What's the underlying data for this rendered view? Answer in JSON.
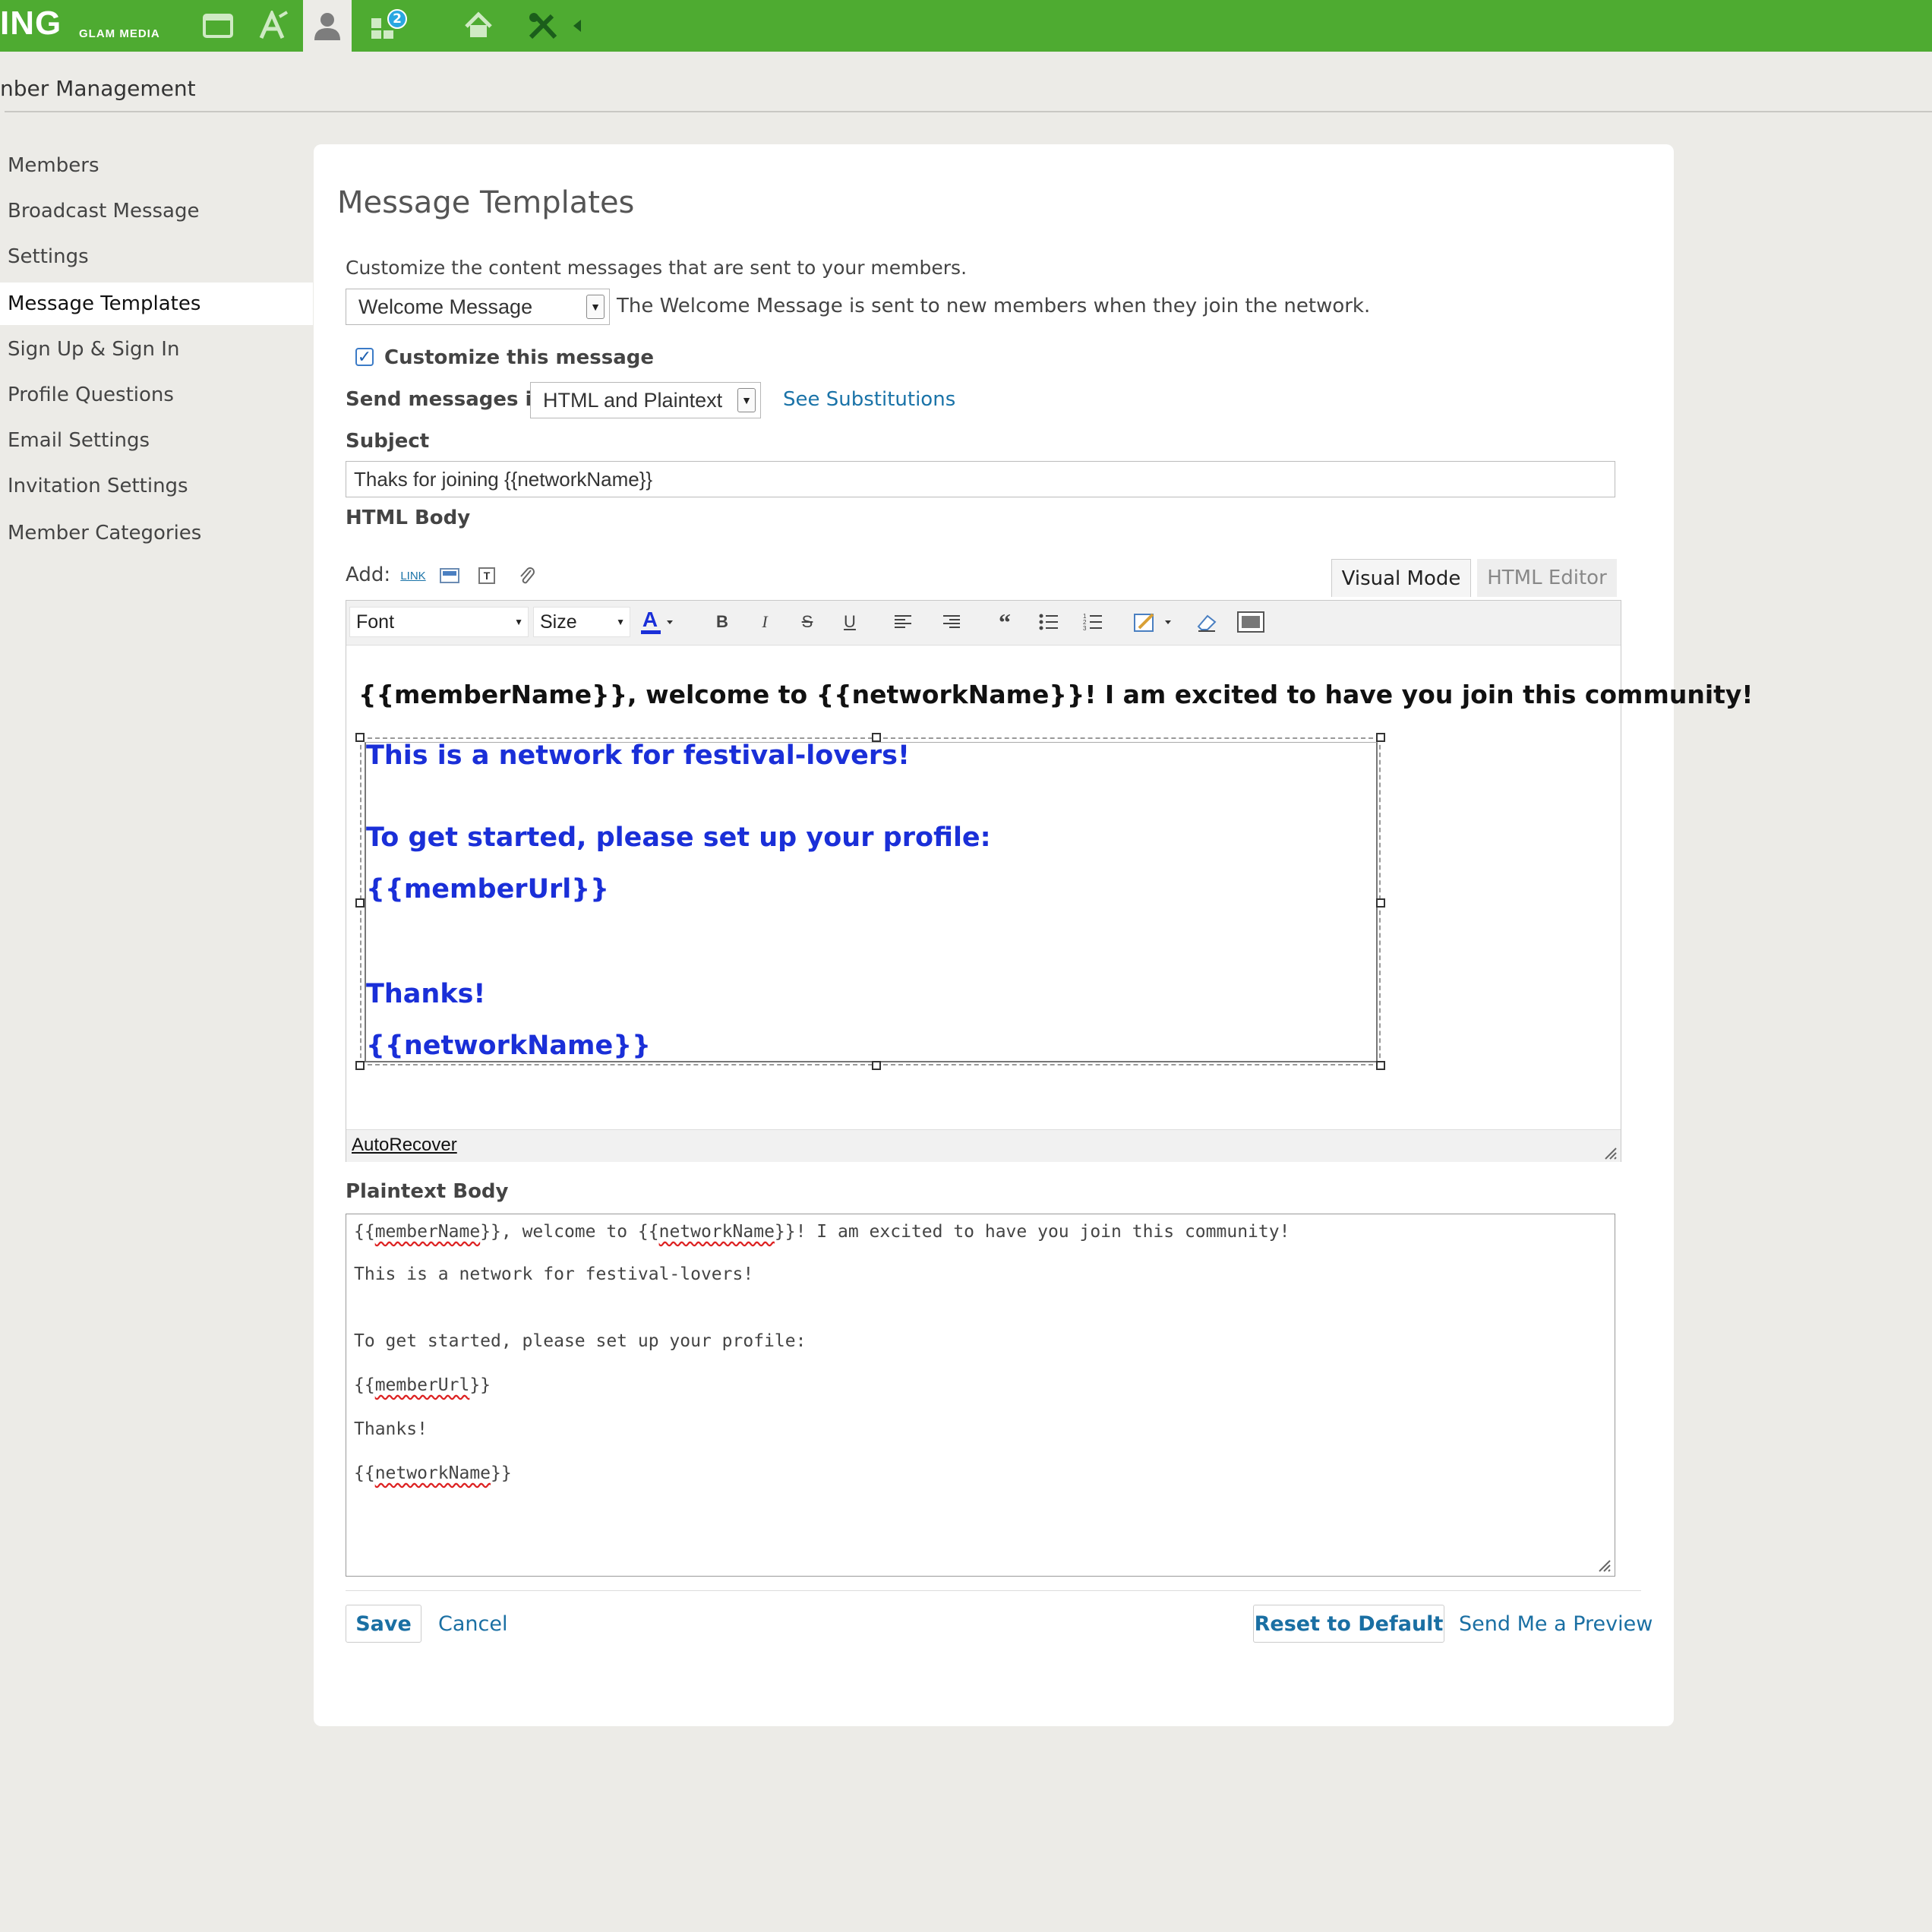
{
  "topbar": {
    "logo": "ING",
    "logo_sub": "GLAM MEDIA",
    "notification_count": "2"
  },
  "section_title": "nber Management",
  "sidebar": {
    "items": [
      {
        "label": "Members"
      },
      {
        "label": "Broadcast Message"
      },
      {
        "label": "Settings"
      },
      {
        "label": "Message Templates"
      },
      {
        "label": "Sign Up & Sign In"
      },
      {
        "label": "Profile Questions"
      },
      {
        "label": "Email Settings"
      },
      {
        "label": "Invitation Settings"
      },
      {
        "label": "Member Categories"
      }
    ]
  },
  "main": {
    "title": "Message Templates",
    "intro": "Customize the content messages that are sent to your members.",
    "template_select": "Welcome Message",
    "template_desc": "The Welcome Message is sent to new members when they join the network.",
    "customize_label": "Customize this message",
    "send_label": "Send messages in",
    "send_select": "HTML and Plaintext",
    "see_substitutions": "See Substitutions",
    "subject_label": "Subject",
    "subject_value": "Thaks for joining {{networkName}}",
    "html_body_label": "HTML Body",
    "add_label": "Add:",
    "add_link": "LINK",
    "tab_visual": "Visual Mode",
    "tab_html": "HTML Editor",
    "toolbar": {
      "font": "Font",
      "size": "Size",
      "bold": "B",
      "italic": "I",
      "strike": "S",
      "underline": "U"
    },
    "html_content": {
      "line1": "{{memberName}}, welcome to {{networkName}}! I am excited to have you join this community!",
      "box_lines": [
        "This is a network for festival-lovers!",
        "To get started, please set up your profile:",
        "{{memberUrl}}",
        "Thanks!",
        "{{networkName}}"
      ]
    },
    "autorecover": "AutoRecover",
    "plaintext_label": "Plaintext Body",
    "plaintext": {
      "l1_a": "{{",
      "l1_b": "memberName",
      "l1_c": "}}, welcome to {{",
      "l1_d": "networkName",
      "l1_e": "}}! I am excited to have you join this community!",
      "l2": "This is a network for festival-lovers!",
      "l3": "To get started, please set up your profile:",
      "l4_a": "{{",
      "l4_b": "memberUrl",
      "l4_c": "}}",
      "l5": "Thanks!",
      "l6_a": "{{",
      "l6_b": "networkName",
      "l6_c": "}}"
    },
    "save": "Save",
    "cancel": "Cancel",
    "reset": "Reset to Default",
    "preview": "Send Me a Preview"
  },
  "colors": {
    "topbar": "#4eab31",
    "link": "#1a6fa3",
    "editor_text_blue": "#1a2fd8"
  }
}
